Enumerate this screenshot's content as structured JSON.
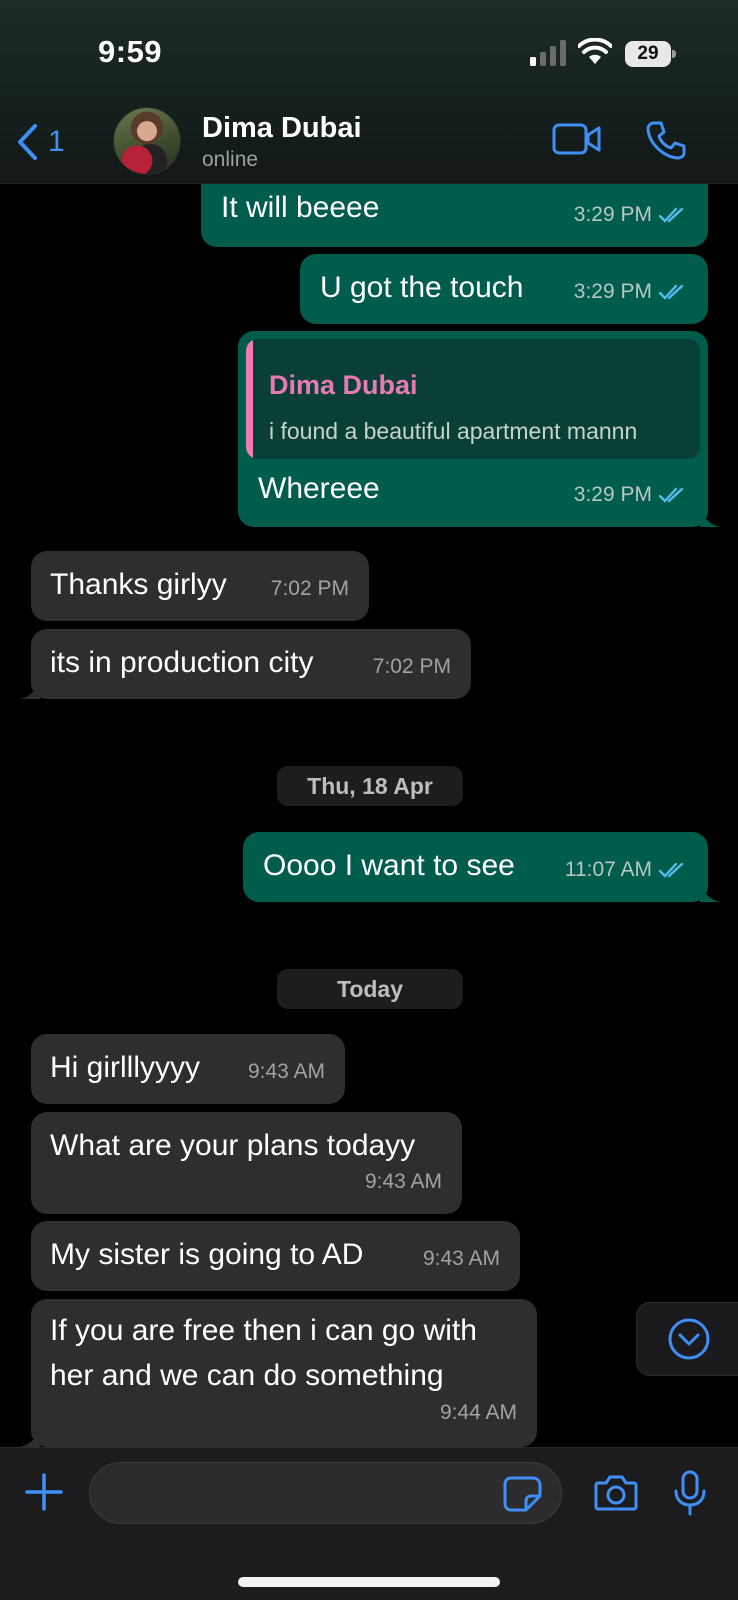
{
  "status_bar": {
    "time": "9:59",
    "battery": "29"
  },
  "header": {
    "back_count": "1",
    "contact_name": "Dima Dubai",
    "contact_status": "online"
  },
  "messages": [
    {
      "dir": "out",
      "text": "It will beeee",
      "time": "3:29 PM"
    },
    {
      "dir": "out",
      "text": "U got the touch",
      "time": "3:29 PM"
    },
    {
      "dir": "out",
      "quote_author": "Dima Dubai",
      "quote_text": "i found a beautiful apartment mannn",
      "text": "Whereee",
      "time": "3:29 PM"
    },
    {
      "dir": "in",
      "text": "Thanks girlyy",
      "time": "7:02 PM"
    },
    {
      "dir": "in",
      "text": "its in production city",
      "time": "7:02 PM"
    },
    {
      "dir": "out",
      "text": "Oooo I want to see",
      "time": "11:07 AM"
    },
    {
      "dir": "in",
      "text": "Hi girlllyyyy",
      "time": "9:43 AM"
    },
    {
      "dir": "in",
      "text": "What are your plans todayy",
      "time": "9:43 AM"
    },
    {
      "dir": "in",
      "text": "My sister is going to AD",
      "time": "9:43 AM"
    },
    {
      "dir": "in",
      "text_line1": "If you are free then i can go with",
      "text_line2": "her and we can do something",
      "time": "9:44 AM"
    }
  ],
  "date_separators": [
    "Thu, 18 Apr",
    "Today"
  ],
  "icons": {
    "back": "chevron-left-icon",
    "video": "video-camera-icon",
    "call": "phone-icon",
    "scroll": "chevron-down-circle-icon",
    "attach": "plus-icon",
    "sticker": "sticker-icon",
    "camera": "camera-icon",
    "mic": "microphone-icon"
  },
  "colors": {
    "accent": "#3f8ff5",
    "outgoing_bubble": "#005c4b",
    "incoming_bubble": "#2e2e30",
    "quote_accent": "#f17bb2",
    "read_ticks": "#53bdeb"
  }
}
